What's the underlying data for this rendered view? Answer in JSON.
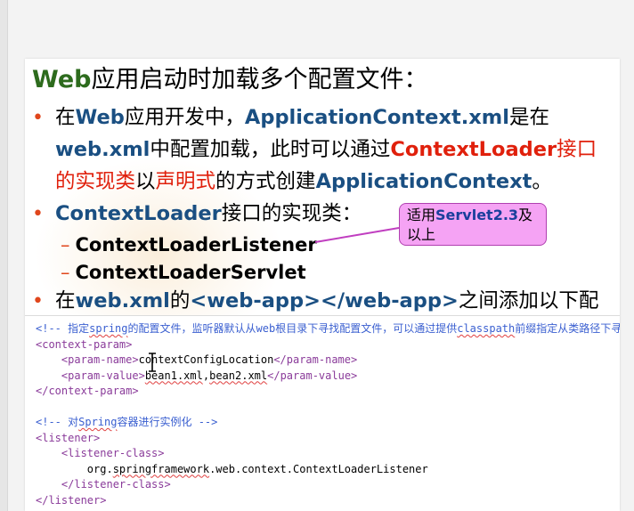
{
  "slide": {
    "title_en": "Web",
    "title_zh": "应用启动时加载多个配置文件：",
    "bullet1": {
      "p1": "在",
      "p2": "Web",
      "p3": "应用开发中，",
      "p4": "ApplicationContext.xml",
      "p5": "是在",
      "p6": "web.xml",
      "p7": "中配置加载，此时可以通过",
      "p8": "ContextLoader",
      "p9": "接口的实现类",
      "p10": "以",
      "p11": "声明式",
      "p12": "的方式创建",
      "p13": "ApplicationContext",
      "p14": "。"
    },
    "bullet2": {
      "p1": "ContextLoader",
      "p2": "接口的实现类："
    },
    "sub_items": [
      "ContextLoaderListener",
      "ContextLoaderServlet"
    ],
    "bullet3": {
      "p1": "在",
      "p2": "web.xml",
      "p3": "的",
      "p4": "<web-app></web-app>",
      "p5": "之间添加以下配置："
    },
    "callout": {
      "p1": "适用",
      "p2": "Servlet2.3",
      "p3": "及以上"
    },
    "bullet_char": "•",
    "dash_char": "–"
  },
  "code": {
    "line1_open": "<!-- ",
    "line1_a": "指定",
    "line1_b": "spring",
    "line1_c": "的配置文件，监听器默认从",
    "line1_d": "web",
    "line1_e": "根目录下寻找配置文件，可以通过提供",
    "line1_f": "classpath",
    "line1_g": "前缀指定从类路径下寻找-->",
    "line2": "<context-param>",
    "line3_tag1": "    <param-name>",
    "line3_text": "contextConfigLocation",
    "line3_tag2": "</param-name>",
    "line4_tag1": "    <param-value>",
    "line4_text1": "bean1.xml",
    "line4_text2": ",",
    "line4_text3": "bean2.xml",
    "line4_tag2": "</param-value>",
    "line5": "</context-param>",
    "line6": "",
    "line7_a": "<!-- 对",
    "line7_b": "Spring",
    "line7_c": "容器进行实例化 -->",
    "line8": "<listener>",
    "line9": "    <listener-class>",
    "line10_a": "        org.",
    "line10_b": "springframework",
    "line10_c": ".web.context.ContextLoaderListener",
    "line11": "    </listener-class>",
    "line12": "</listener>"
  }
}
